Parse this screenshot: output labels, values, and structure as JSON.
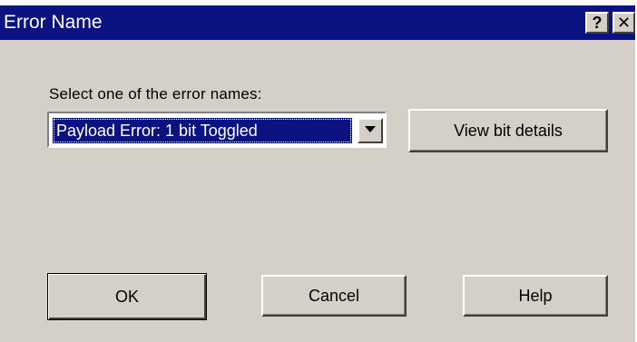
{
  "window": {
    "title": "Error Name",
    "help_button_label": "?",
    "close_button_label": "✕"
  },
  "form": {
    "prompt": "Select one of the error names:",
    "error_select": {
      "selected_value": "Payload Error: 1 bit Toggled"
    },
    "view_bit_details_label": "View bit details"
  },
  "actions": {
    "ok_label": "OK",
    "cancel_label": "Cancel",
    "help_label": "Help"
  },
  "icons": {
    "dropdown": "chevron-down-icon",
    "help": "question-mark-icon",
    "close": "close-icon"
  },
  "colors": {
    "titlebar": "#0a1380",
    "selection": "#0a1380",
    "dialog_background": "#d4d0c8"
  }
}
